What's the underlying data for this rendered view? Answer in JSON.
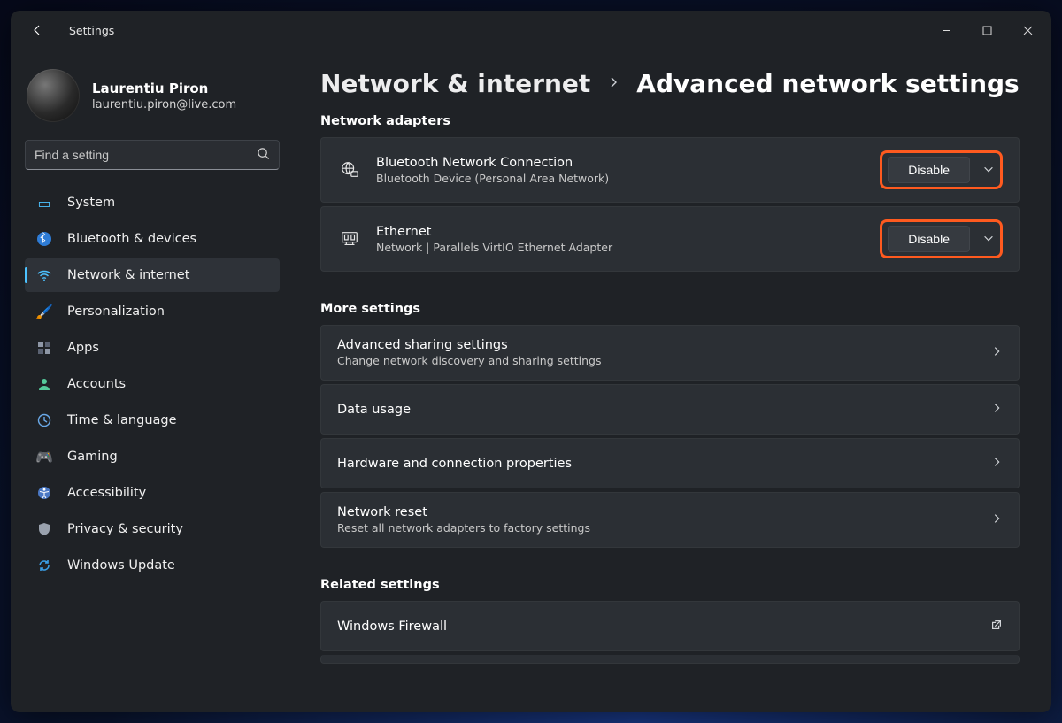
{
  "window": {
    "title": "Settings"
  },
  "user": {
    "name": "Laurentiu Piron",
    "email": "laurentiu.piron@live.com"
  },
  "search": {
    "placeholder": "Find a setting"
  },
  "sidebar": {
    "items": [
      {
        "label": "System"
      },
      {
        "label": "Bluetooth & devices"
      },
      {
        "label": "Network & internet"
      },
      {
        "label": "Personalization"
      },
      {
        "label": "Apps"
      },
      {
        "label": "Accounts"
      },
      {
        "label": "Time & language"
      },
      {
        "label": "Gaming"
      },
      {
        "label": "Accessibility"
      },
      {
        "label": "Privacy & security"
      },
      {
        "label": "Windows Update"
      }
    ],
    "activeIndex": 2
  },
  "breadcrumb": {
    "parent": "Network & internet",
    "current": "Advanced network settings"
  },
  "sections": {
    "adapters_label": "Network adapters",
    "more_label": "More settings",
    "related_label": "Related settings"
  },
  "adapters": [
    {
      "title": "Bluetooth Network Connection",
      "subtitle": "Bluetooth Device (Personal Area Network)",
      "action": "Disable"
    },
    {
      "title": "Ethernet",
      "subtitle": "Network | Parallels VirtIO Ethernet Adapter",
      "action": "Disable"
    }
  ],
  "more": [
    {
      "title": "Advanced sharing settings",
      "subtitle": "Change network discovery and sharing settings"
    },
    {
      "title": "Data usage",
      "subtitle": ""
    },
    {
      "title": "Hardware and connection properties",
      "subtitle": ""
    },
    {
      "title": "Network reset",
      "subtitle": "Reset all network adapters to factory settings"
    }
  ],
  "related": [
    {
      "title": "Windows Firewall"
    }
  ]
}
